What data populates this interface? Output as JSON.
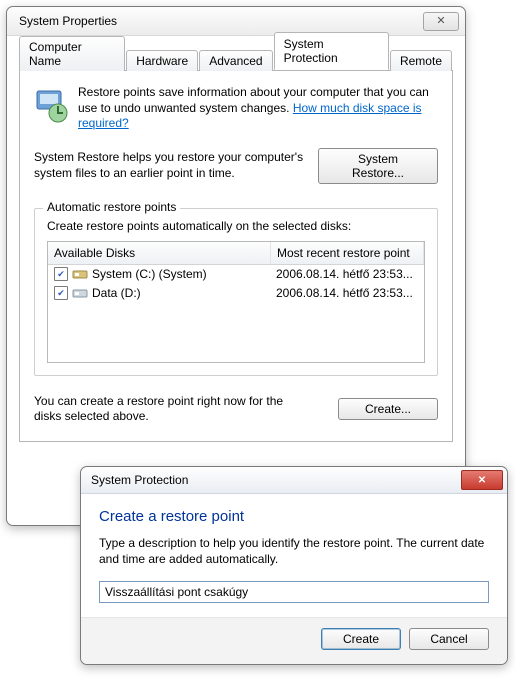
{
  "main": {
    "title": "System Properties",
    "close_glyph": "✕",
    "tabs": [
      {
        "label": "Computer Name"
      },
      {
        "label": "Hardware"
      },
      {
        "label": "Advanced"
      },
      {
        "label": "System Protection"
      },
      {
        "label": "Remote"
      }
    ],
    "intro_text_a": "Restore points save information about your computer that you can use to undo unwanted system changes. ",
    "intro_link": "How much disk space is required?",
    "help_text": "System Restore helps you restore your computer's system files to an earlier point in time.",
    "system_restore_btn": "System Restore...",
    "group_title": "Automatic restore points",
    "group_sub": "Create restore points automatically on the selected disks:",
    "col_disks": "Available Disks",
    "col_recent": "Most recent restore point",
    "rows": [
      {
        "checked": true,
        "icon": "hdd-system",
        "name": "System (C:) (System)",
        "recent": "2006.08.14. hétfő 23:53..."
      },
      {
        "checked": true,
        "icon": "hdd",
        "name": "Data (D:)",
        "recent": "2006.08.14. hétfő 23:53..."
      }
    ],
    "create_text": "You can create a restore point right now for the disks selected above.",
    "create_btn": "Create..."
  },
  "dialog": {
    "title": "System Protection",
    "close_glyph": "✕",
    "heading": "Create a restore point",
    "text": "Type a description to help you identify the restore point. The current date and time are added automatically.",
    "input_value": "Visszaállítási pont csakúgy",
    "create_btn": "Create",
    "cancel_btn": "Cancel"
  }
}
